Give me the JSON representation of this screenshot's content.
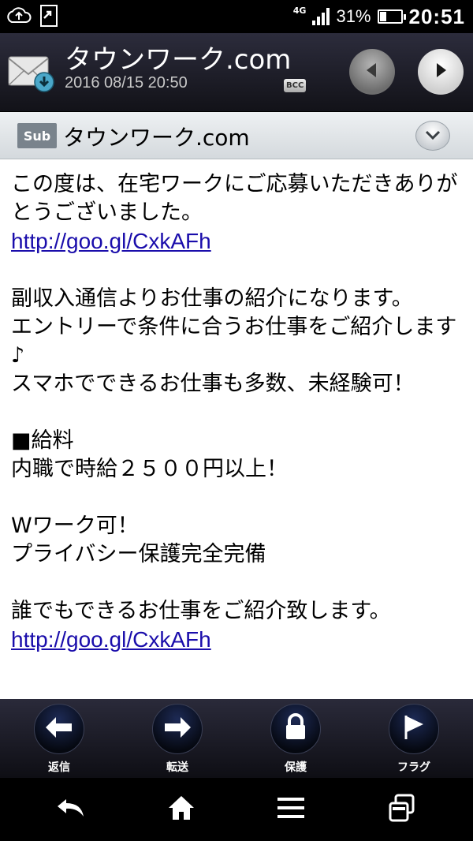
{
  "status": {
    "network": "4G",
    "battery_text": "31%",
    "time": "20:51",
    "icons": [
      "cloud-icon",
      "exit-icon",
      "signal-icon",
      "battery-icon"
    ]
  },
  "header": {
    "title": "タウンワーク.com",
    "date": "2016 08/15 20:50",
    "bcc_label": "BCC",
    "icons": {
      "mail": "mail-envelope-icon",
      "prev": "prev-arrow-icon",
      "next": "next-arrow-icon"
    }
  },
  "subject": {
    "badge": "Sub",
    "text": "タウンワーク.com"
  },
  "body": {
    "para1": "この度は、在宅ワークにご応募いただきありがとうございました。",
    "link1": "http://goo.gl/CxkAFh",
    "para2_line1": "副収入通信よりお仕事の紹介になります。",
    "para2_line2": "エントリーで条件に合うお仕事をご紹介します♪",
    "para2_line3": "スマホでできるお仕事も多数、未経験可！",
    "para3_line1": "■給料",
    "para3_line2": "内職で時給２５００円以上！",
    "para4_line1": "Wワーク可！",
    "para4_line2": "プライバシー保護完全完備",
    "para5": "誰でもできるお仕事をご紹介致します。",
    "link2": "http://goo.gl/CxkAFh"
  },
  "actions": {
    "reply": "返信",
    "forward": "転送",
    "protect": "保護",
    "flag": "フラグ"
  },
  "colors": {
    "link": "#1a0dab",
    "header_bg": "#1c1c26",
    "subject_bg": "#e2e6e9"
  }
}
